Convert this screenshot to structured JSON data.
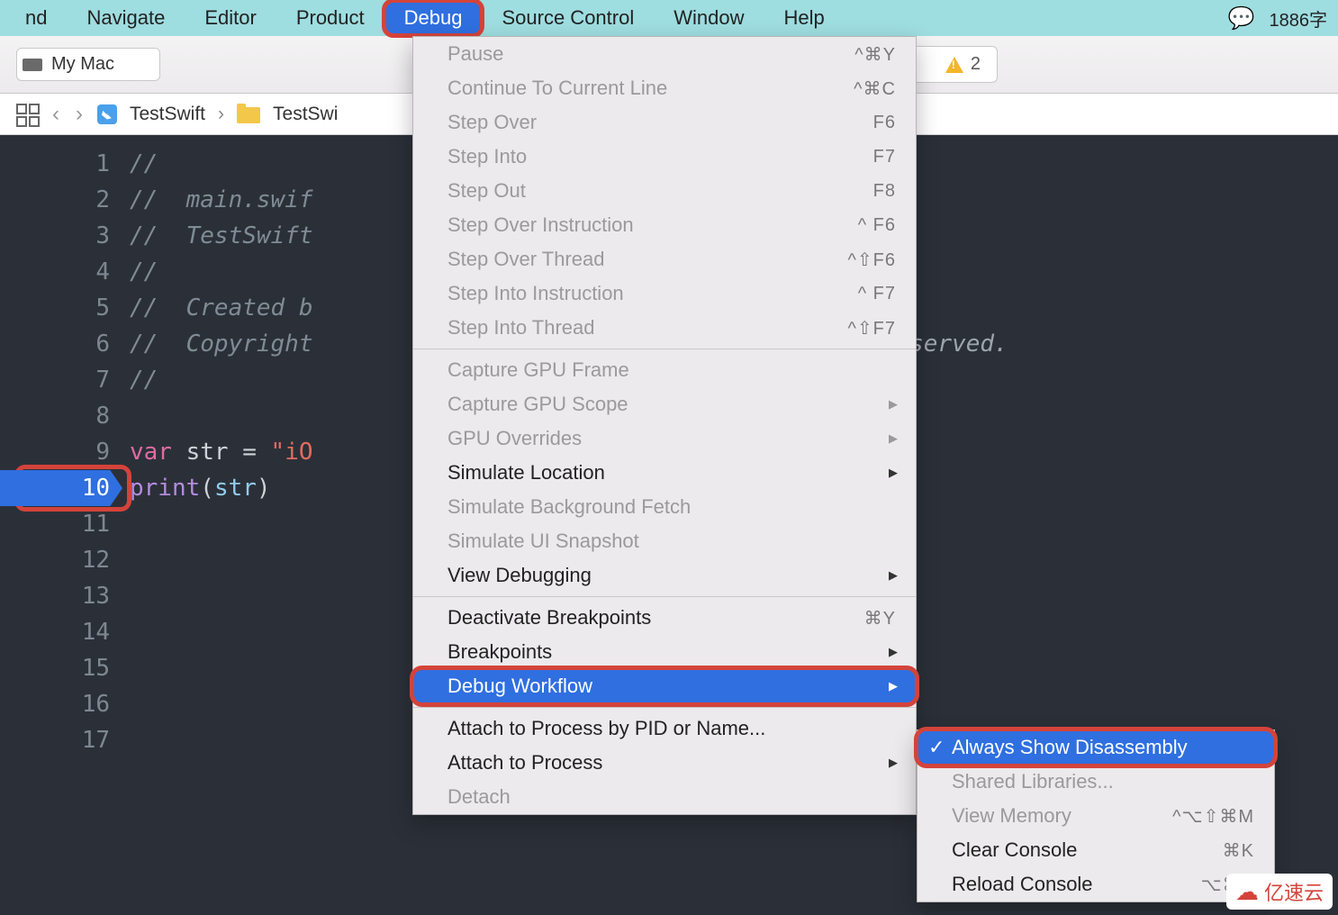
{
  "menubar": {
    "items": [
      "nd",
      "Navigate",
      "Editor",
      "Product",
      "Debug",
      "Source Control",
      "Window",
      "Help"
    ],
    "active_index": 4,
    "right_text": "1886字"
  },
  "toolbar": {
    "scheme": "My Mac",
    "center": "TestSwi",
    "warn_count": "2"
  },
  "pathbar": {
    "proj": "TestSwift",
    "folder": "TestSwi"
  },
  "editor": {
    "lines": [
      {
        "n": "1",
        "t": "//",
        "cls": "c-comment"
      },
      {
        "n": "2",
        "pre": "//  ",
        "t": "main.swif",
        "cls": "c-comment"
      },
      {
        "n": "3",
        "pre": "//  ",
        "t": "TestSwift",
        "cls": "c-comment"
      },
      {
        "n": "4",
        "t": "//",
        "cls": "c-comment"
      },
      {
        "n": "5",
        "pre": "//  ",
        "t": "Created b",
        "cls": "c-comment"
      },
      {
        "n": "6",
        "pre": "//  ",
        "t": "Copyright",
        "cls": "c-comment",
        "tail": "s reserved."
      },
      {
        "n": "7",
        "t": "//",
        "cls": "c-comment"
      },
      {
        "n": "8",
        "t": ""
      },
      {
        "n": "9",
        "code9": true
      },
      {
        "n": "10",
        "code10": true,
        "bp": true
      },
      {
        "n": "11",
        "t": ""
      },
      {
        "n": "12",
        "t": ""
      },
      {
        "n": "13",
        "t": ""
      },
      {
        "n": "14",
        "t": ""
      },
      {
        "n": "15",
        "t": ""
      },
      {
        "n": "16",
        "t": ""
      },
      {
        "n": "17",
        "t": ""
      }
    ],
    "line9": {
      "kw": "var",
      "sp": " ",
      "id": "str",
      "eq": " = ",
      "str": "\"iO"
    },
    "line10": {
      "fn": "print",
      "paren1": "(",
      "id": "str",
      "paren2": ")"
    }
  },
  "menu1": [
    {
      "t": "Pause",
      "sc": "^⌘Y",
      "disabled": true
    },
    {
      "t": "Continue To Current Line",
      "sc": "^⌘C",
      "disabled": true
    },
    {
      "t": "Step Over",
      "sc": "F6",
      "disabled": true
    },
    {
      "t": "Step Into",
      "sc": "F7",
      "disabled": true
    },
    {
      "t": "Step Out",
      "sc": "F8",
      "disabled": true
    },
    {
      "t": "Step Over Instruction",
      "sc": "^    F6",
      "disabled": true
    },
    {
      "t": "Step Over Thread",
      "sc": "^⇧F6",
      "disabled": true
    },
    {
      "t": "Step Into Instruction",
      "sc": "^    F7",
      "disabled": true
    },
    {
      "t": "Step Into Thread",
      "sc": "^⇧F7",
      "disabled": true
    },
    {
      "sep": true
    },
    {
      "t": "Capture GPU Frame",
      "disabled": true
    },
    {
      "t": "Capture GPU Scope",
      "disabled": true,
      "sub": true
    },
    {
      "t": "GPU Overrides",
      "disabled": true,
      "sub": true
    },
    {
      "t": "Simulate Location",
      "sub": true
    },
    {
      "t": "Simulate Background Fetch",
      "disabled": true
    },
    {
      "t": "Simulate UI Snapshot",
      "disabled": true
    },
    {
      "t": "View Debugging",
      "sub": true
    },
    {
      "sep": true
    },
    {
      "t": "Deactivate Breakpoints",
      "sc": "⌘Y"
    },
    {
      "t": "Breakpoints",
      "sub": true
    },
    {
      "t": "Debug Workflow",
      "sub": true,
      "hl": true,
      "box": true
    },
    {
      "sep": true
    },
    {
      "t": "Attach to Process by PID or Name..."
    },
    {
      "t": "Attach to Process",
      "sub": true
    },
    {
      "t": "Detach",
      "disabled": true
    }
  ],
  "menu2": [
    {
      "t": "Always Show Disassembly",
      "hl": true,
      "box": true,
      "check": "✓"
    },
    {
      "t": "Shared Libraries...",
      "disabled": true
    },
    {
      "t": "View Memory",
      "sc": "^⌥⇧⌘M",
      "disabled": true
    },
    {
      "t": "Clear Console",
      "sc": "⌘K"
    },
    {
      "t": "Reload Console",
      "sc": "⌥⌘K"
    }
  ],
  "watermark": "亿速云"
}
